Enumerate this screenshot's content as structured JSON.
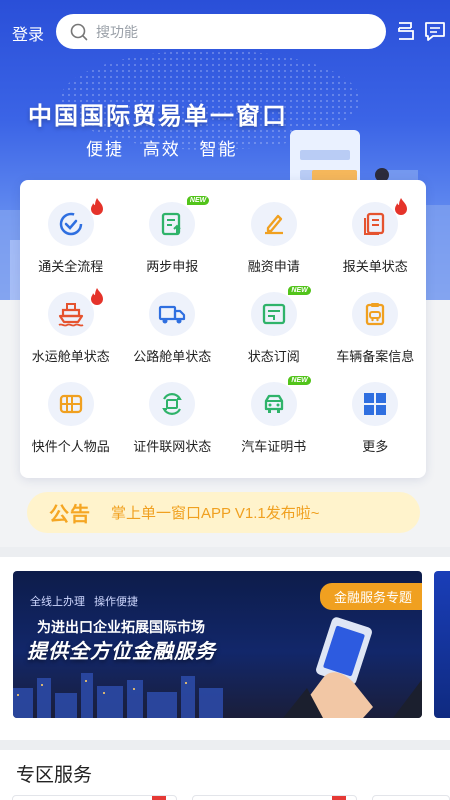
{
  "header": {
    "login_label": "登录",
    "search_placeholder": "搜功能",
    "icons": [
      "scan-icon",
      "message-icon"
    ]
  },
  "hero": {
    "title": "中国国际贸易单一窗口",
    "subtitles": [
      "便捷",
      "高效",
      "智能"
    ]
  },
  "services": [
    {
      "label": "通关全流程",
      "icon": "cycle-icon",
      "badge": "hot"
    },
    {
      "label": "两步申报",
      "icon": "declare-icon",
      "badge": "new"
    },
    {
      "label": "融资申请",
      "icon": "edit-icon",
      "badge": ""
    },
    {
      "label": "报关单状态",
      "icon": "document-icon",
      "badge": "hot"
    },
    {
      "label": "水运舱单状态",
      "icon": "ship-icon",
      "badge": "hot"
    },
    {
      "label": "公路舱单状态",
      "icon": "truck-icon",
      "badge": ""
    },
    {
      "label": "状态订阅",
      "icon": "subscribe-icon",
      "badge": "new"
    },
    {
      "label": "车辆备案信息",
      "icon": "vehicle-record-icon",
      "badge": ""
    },
    {
      "label": "快件个人物品",
      "icon": "parcel-icon",
      "badge": ""
    },
    {
      "label": "证件联网状态",
      "icon": "certificate-network-icon",
      "badge": ""
    },
    {
      "label": "汽车证明书",
      "icon": "car-certificate-icon",
      "badge": "new"
    },
    {
      "label": "更多",
      "icon": "more-grid-icon",
      "badge": ""
    }
  ],
  "badge_new_text": "NEW",
  "notice": {
    "tag": "公告",
    "text": "掌上单一窗口APP V1.1发布啦~"
  },
  "banner": {
    "tag": "金融服务专题",
    "line1": [
      "全线上办理",
      "操作便捷"
    ],
    "line2": "为进出口企业拓展国际市场",
    "line3": "提供全方位金融服务"
  },
  "zone": {
    "title": "专区服务"
  },
  "colors": {
    "primary": "#3b64e6",
    "icon_blue": "#2f6fe0",
    "icon_orange": "#f0a020",
    "icon_red": "#e5532f",
    "icon_green": "#2fb36a",
    "notice_text": "#f0a020"
  }
}
